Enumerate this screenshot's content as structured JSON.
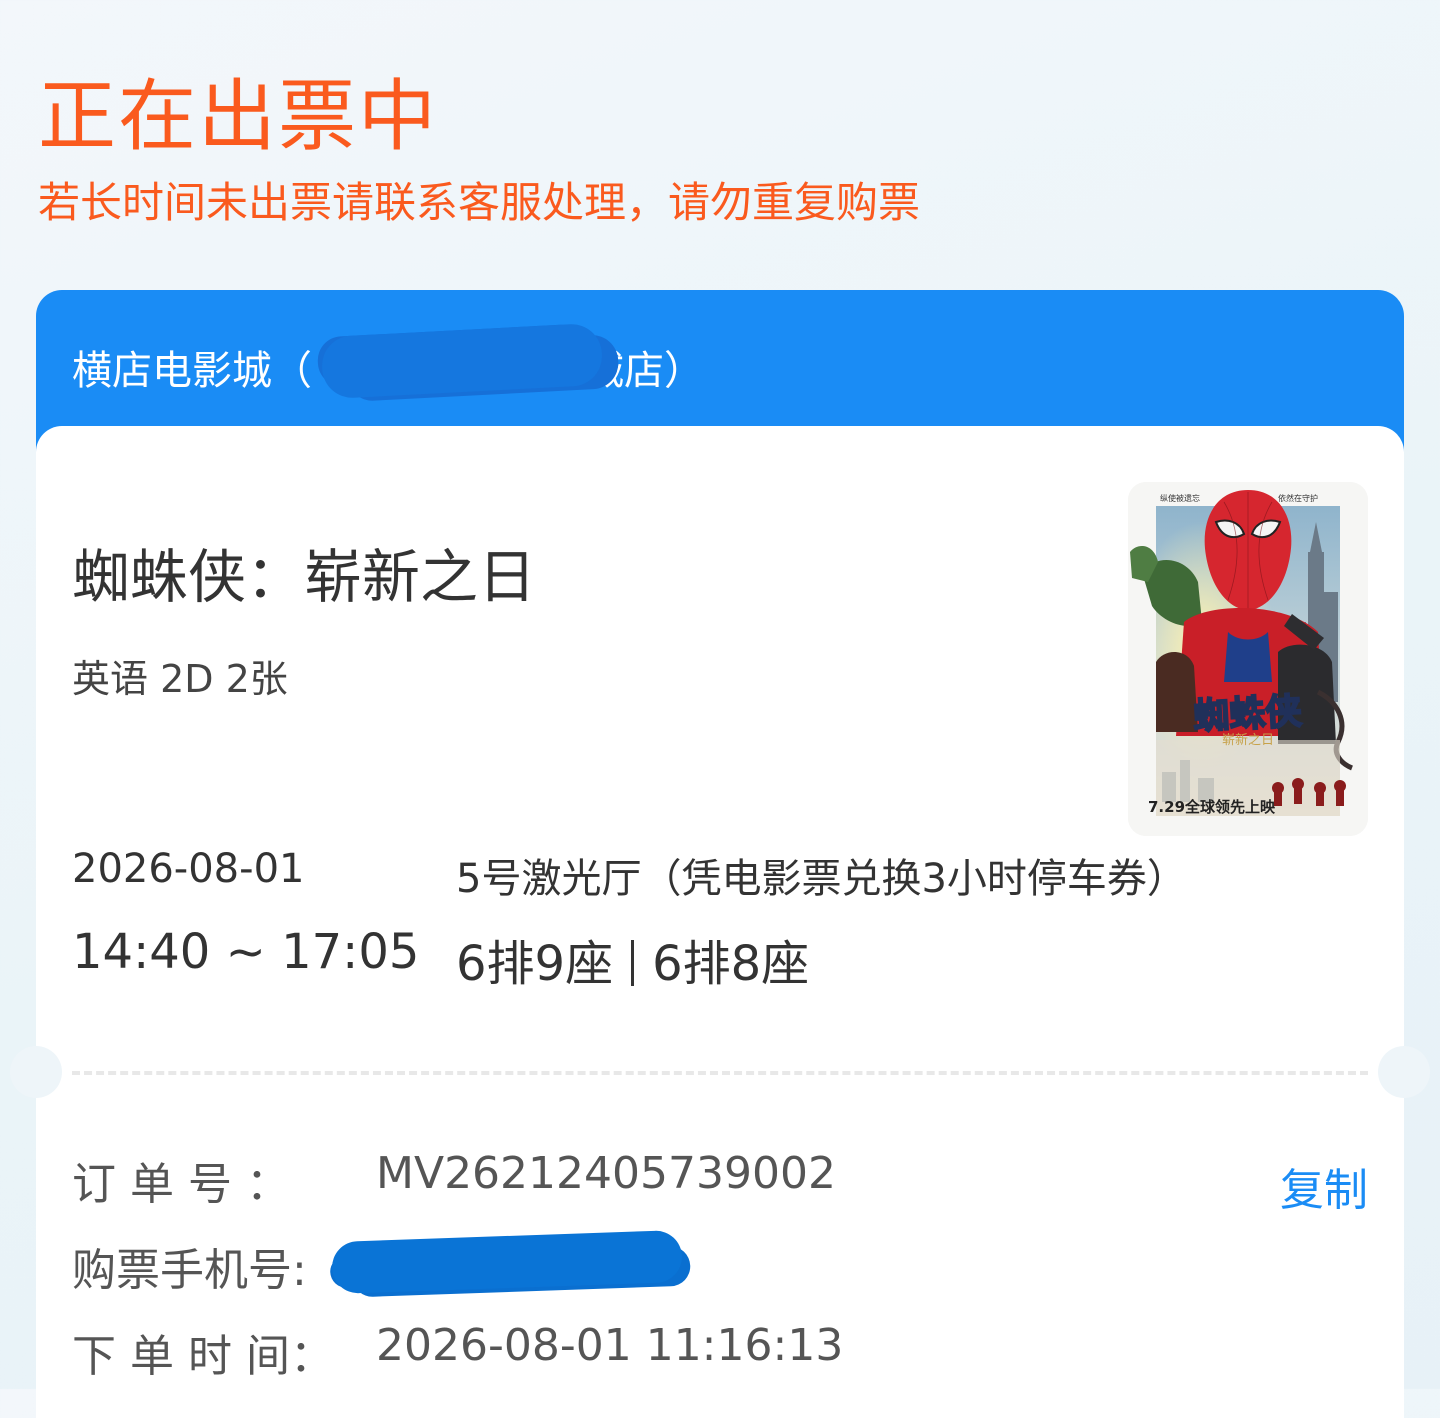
{
  "status": {
    "title": "正在出票中",
    "subtitle": "若长时间未出票请联系客服处理，请勿重复购票"
  },
  "ticket": {
    "cinema_name": "横店电影城（",
    "cinema_name_tail": "城店）",
    "movie_title": "蜘蛛侠：崭新之日",
    "meta": "英语 2D 2张",
    "date": "2026-08-01",
    "hall": "5号激光厅（凭电影票兑换3小时停车券）",
    "time": "14:40 ~ 17:05",
    "seats": [
      "6排9座",
      "6排8座"
    ],
    "poster": {
      "top_left": "纵使被遗忘",
      "top_right": "依然在守护",
      "title": "蜘蛛侠",
      "subtitle": "崭新之日",
      "release": "7.29全球领先上映"
    }
  },
  "order": {
    "order_no_label": "订 单 号 ：",
    "order_no": "MV26212405739002",
    "copy_label": "复制",
    "phone_label": "购票手机号:",
    "order_time_label": "下 单 时 间：",
    "order_time": "2026-08-01 11:16:13"
  },
  "colors": {
    "accent_orange": "#fa5a1e",
    "header_blue": "#1a8cf5",
    "redaction_blue": "#0a74d6"
  }
}
